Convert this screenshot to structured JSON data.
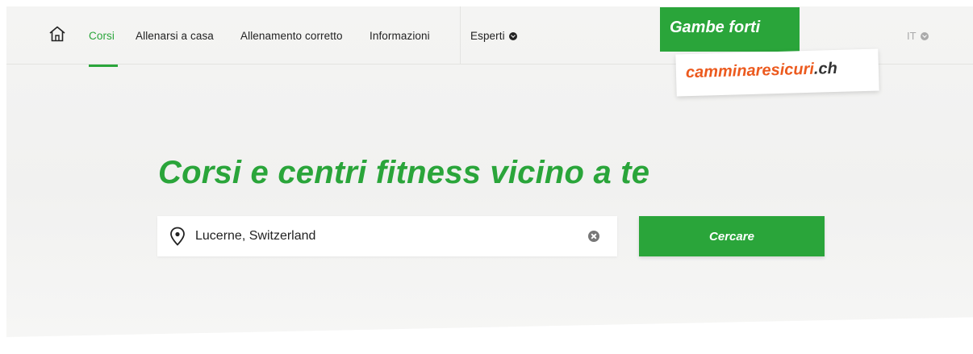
{
  "nav": {
    "items": [
      {
        "label": "Corsi",
        "active": true
      },
      {
        "label": "Allenarsi a casa"
      },
      {
        "label": "Allenamento corretto"
      },
      {
        "label": "Informazioni"
      },
      {
        "label": "Esperti"
      }
    ],
    "language": "IT"
  },
  "brand": {
    "line1": "Gambe forti",
    "line2_part1": "camminare",
    "line2_part2": "sicuri",
    "line2_part3": ".ch"
  },
  "hero": {
    "headline": "Corsi e centri fitness vicino a te",
    "search_value": "Lucerne, Switzerland",
    "search_button": "Cercare"
  },
  "colors": {
    "accent_green": "#2aa53a",
    "brand_orange": "#ec5a1e"
  }
}
